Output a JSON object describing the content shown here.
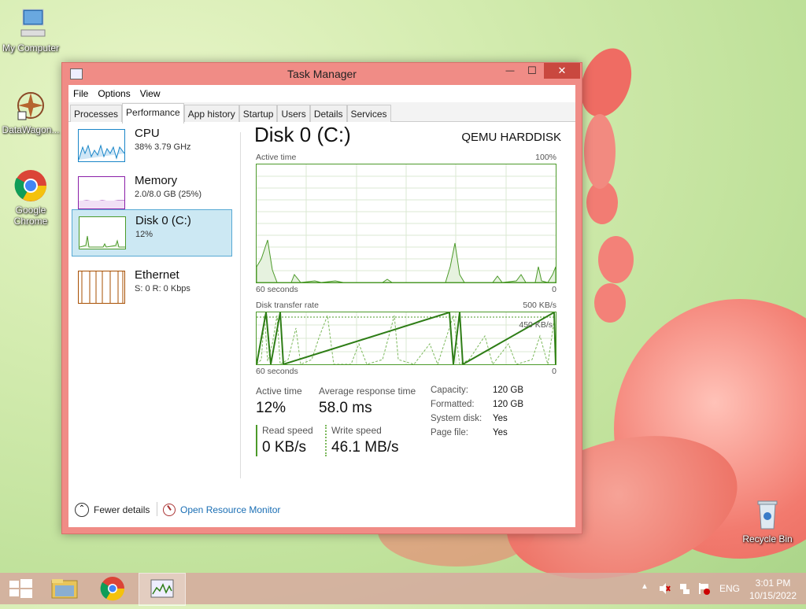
{
  "desktop": {
    "icons": [
      {
        "label": "My Computer"
      },
      {
        "label": "DataWagon..."
      },
      {
        "label": "Google Chrome"
      },
      {
        "label": "Recycle Bin"
      }
    ]
  },
  "window": {
    "title": "Task Manager",
    "controls": {
      "minimize": "—",
      "maximize": "☐",
      "close": "✕"
    },
    "menu": [
      "File",
      "Options",
      "View"
    ],
    "tabs": [
      "Processes",
      "Performance",
      "App history",
      "Startup",
      "Users",
      "Details",
      "Services"
    ],
    "active_tab": "Performance"
  },
  "resources": [
    {
      "name": "CPU",
      "sub": "38%  3.79 GHz",
      "color": "#1a86c8"
    },
    {
      "name": "Memory",
      "sub": "2.0/8.0 GB (25%)",
      "color": "#8b1fa8"
    },
    {
      "name": "Disk 0 (C:)",
      "sub": "12%",
      "color": "#4c9a2a"
    },
    {
      "name": "Ethernet",
      "sub": "S: 0 R: 0 Kbps",
      "color": "#a74f01"
    }
  ],
  "detail": {
    "title": "Disk 0 (C:)",
    "model": "QEMU HARDDISK",
    "graph1": {
      "label": "Active time",
      "max": "100%",
      "xlabel": "60 seconds",
      "min": "0"
    },
    "graph2": {
      "label": "Disk transfer rate",
      "max": "500 KB/s",
      "mid": "450 KB/s",
      "xlabel": "60 seconds",
      "min": "0"
    },
    "active_time_label": "Active time",
    "active_time_value": "12%",
    "avg_resp_label": "Average response time",
    "avg_resp_value": "58.0 ms",
    "read_label": "Read speed",
    "read_value": "0 KB/s",
    "write_label": "Write speed",
    "write_value": "46.1 MB/s",
    "info": [
      {
        "k": "Capacity:",
        "v": "120 GB"
      },
      {
        "k": "Formatted:",
        "v": "120 GB"
      },
      {
        "k": "System disk:",
        "v": "Yes"
      },
      {
        "k": "Page file:",
        "v": "Yes"
      }
    ]
  },
  "footer": {
    "fewer": "Fewer details",
    "monitor": "Open Resource Monitor"
  },
  "taskbar": {
    "lang": "ENG",
    "time": "3:01 PM",
    "date": "10/15/2022"
  },
  "colors": {
    "disk": "#4c9a2a",
    "accent": "#1a6eb4"
  }
}
